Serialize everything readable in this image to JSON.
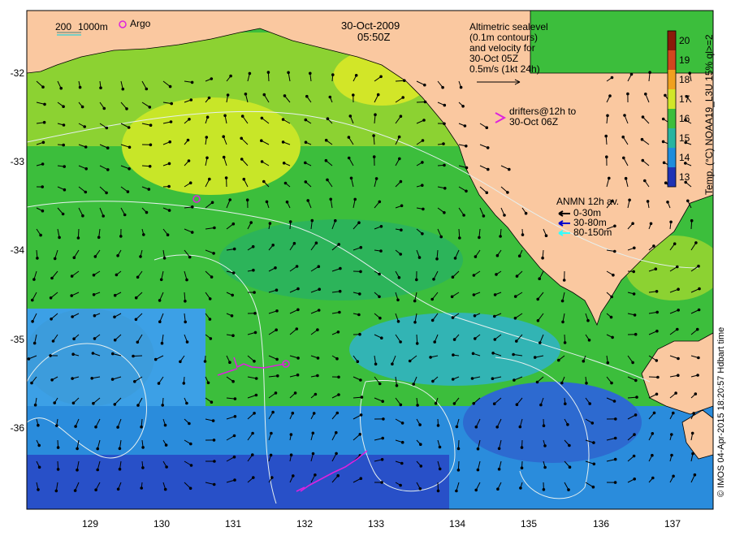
{
  "header": {
    "date": "30-Oct-2009",
    "time": "05:50Z"
  },
  "top_left": {
    "depth_200": "200",
    "depth_1000": "1000m",
    "argo_label": "Argo"
  },
  "altimetry_note": [
    "Altimetric sealevel",
    "(0.1m contours)",
    "and velocity for",
    "30-Oct 05Z",
    "0.5m/s (1kt 24h)"
  ],
  "drifters_note": [
    "drifters@12h to",
    "30-Oct 06Z"
  ],
  "anmn": {
    "title": "ANMN 12h av.",
    "items": [
      {
        "label": "0-30m",
        "color": "#000000"
      },
      {
        "label": "30-80m",
        "color": "#0000cc"
      },
      {
        "label": "80-150m",
        "color": "#33ffff"
      }
    ]
  },
  "colorbar": {
    "title": "Temp. (°C) NOAA19_L3U 15% ql>=2",
    "ticks": [
      "20",
      "19",
      "18",
      "17",
      "16",
      "15",
      "14",
      "13"
    ]
  },
  "axes": {
    "y_ticks": [
      "-32",
      "-33",
      "-34",
      "-35",
      "-36"
    ],
    "x_ticks": [
      "129",
      "130",
      "131",
      "132",
      "133",
      "134",
      "135",
      "136",
      "137"
    ]
  },
  "credit": "© IMOS 04-Apr-2015 18:20:57 Hdbart time",
  "colors": {
    "land": "#fac8a0",
    "sst_warm": "#d7e61e",
    "sst_mid": "#3cbe3c",
    "sst_cool": "#1e8cdc",
    "sst_cold": "#1e32b4",
    "drifter": "#dd22dd"
  }
}
